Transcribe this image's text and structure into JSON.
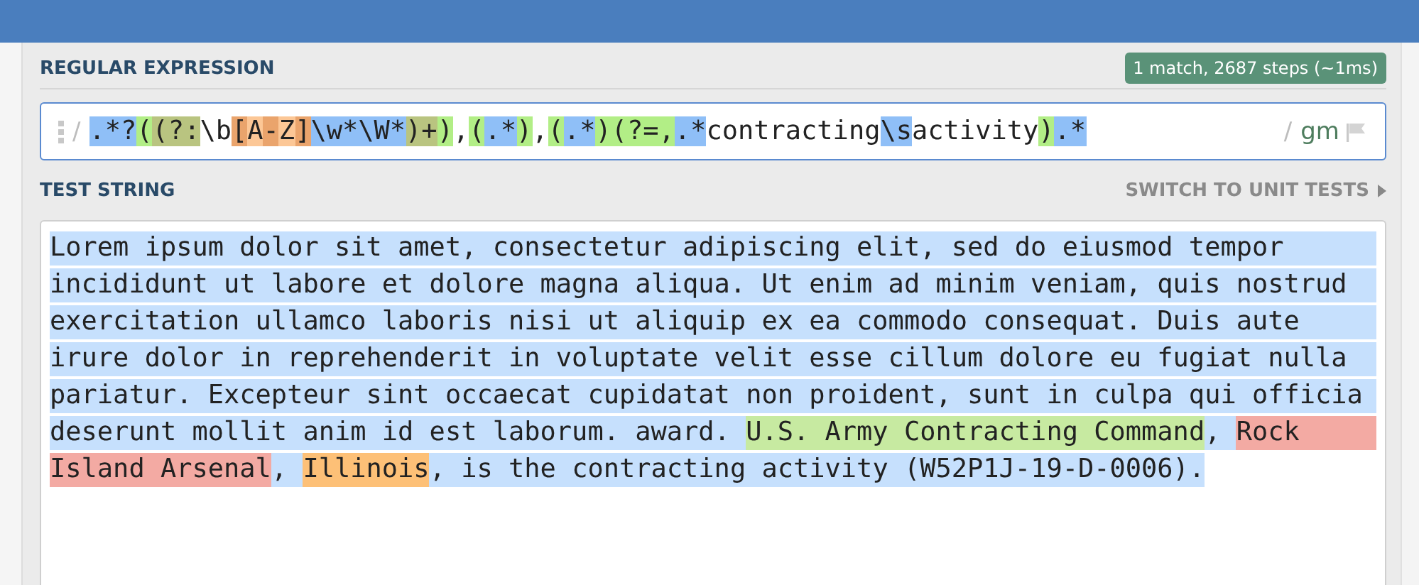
{
  "regex_section": {
    "heading": "REGULAR EXPRESSION",
    "result_badge": "1 match, 2687 steps (~1ms)",
    "delimiter_open": "/",
    "tokens": [
      {
        "text": ".*?",
        "kind": "quantifier"
      },
      {
        "text": "(",
        "kind": "group"
      },
      {
        "text": "(?:",
        "kind": "noncapture"
      },
      {
        "text": "\\b",
        "kind": "plain"
      },
      {
        "text": "[",
        "kind": "set"
      },
      {
        "text": "A",
        "kind": "setitem"
      },
      {
        "text": "-",
        "kind": "set"
      },
      {
        "text": "Z",
        "kind": "setitem"
      },
      {
        "text": "]",
        "kind": "set"
      },
      {
        "text": "\\w*\\W*",
        "kind": "quantifier"
      },
      {
        "text": ")+",
        "kind": "noncapture"
      },
      {
        "text": ")",
        "kind": "group"
      },
      {
        "text": ",",
        "kind": "plain"
      },
      {
        "text": "(",
        "kind": "group"
      },
      {
        "text": ".*",
        "kind": "quantifier"
      },
      {
        "text": ")",
        "kind": "group"
      },
      {
        "text": ",",
        "kind": "plain"
      },
      {
        "text": "(",
        "kind": "group"
      },
      {
        "text": ".*",
        "kind": "quantifier"
      },
      {
        "text": ")",
        "kind": "group"
      },
      {
        "text": "(?=,",
        "kind": "group"
      },
      {
        "text": ".*",
        "kind": "quantifier"
      },
      {
        "text": "contracting",
        "kind": "plain"
      },
      {
        "text": "\\s",
        "kind": "quantifier"
      },
      {
        "text": "activity",
        "kind": "plain"
      },
      {
        "text": ")",
        "kind": "group"
      },
      {
        "text": ".*",
        "kind": "quantifier"
      }
    ],
    "delimiter_close": "/",
    "flags": "gm"
  },
  "test_section": {
    "heading": "TEST STRING",
    "switch_link": "SWITCH TO UNIT TESTS",
    "lines": [
      [
        {
          "text": "Lorem ipsum dolor sit amet, consectetur adipiscing elit, sed do eiusmod tempor",
          "kind": "match"
        }
      ],
      [
        {
          "text": "incididunt ut labore et dolore magna aliqua. Ut enim ad minim veniam, quis nostrud",
          "kind": "match"
        }
      ],
      [
        {
          "text": "exercitation ullamco laboris nisi ut aliquip ex ea commodo consequat. Duis aute",
          "kind": "match"
        }
      ],
      [
        {
          "text": "irure dolor in reprehenderit in voluptate velit esse cillum dolore eu fugiat nulla",
          "kind": "match"
        }
      ],
      [
        {
          "text": "pariatur. Excepteur sint occaecat cupidatat non proident, sunt in culpa qui officia",
          "kind": "match"
        }
      ],
      [
        {
          "text": "deserunt mollit anim id est laborum. award. ",
          "kind": "match"
        },
        {
          "text": "U.S. Army Contracting Command",
          "kind": "group1"
        },
        {
          "text": ", ",
          "kind": "match"
        },
        {
          "text": "Rock",
          "kind": "group2"
        }
      ],
      [
        {
          "text": "Island Arsenal",
          "kind": "group2"
        },
        {
          "text": ", ",
          "kind": "match"
        },
        {
          "text": "Illinois",
          "kind": "group3"
        },
        {
          "text": ", is the contracting activity (W52P1J-19-D-0006).",
          "kind": "match"
        }
      ]
    ]
  }
}
